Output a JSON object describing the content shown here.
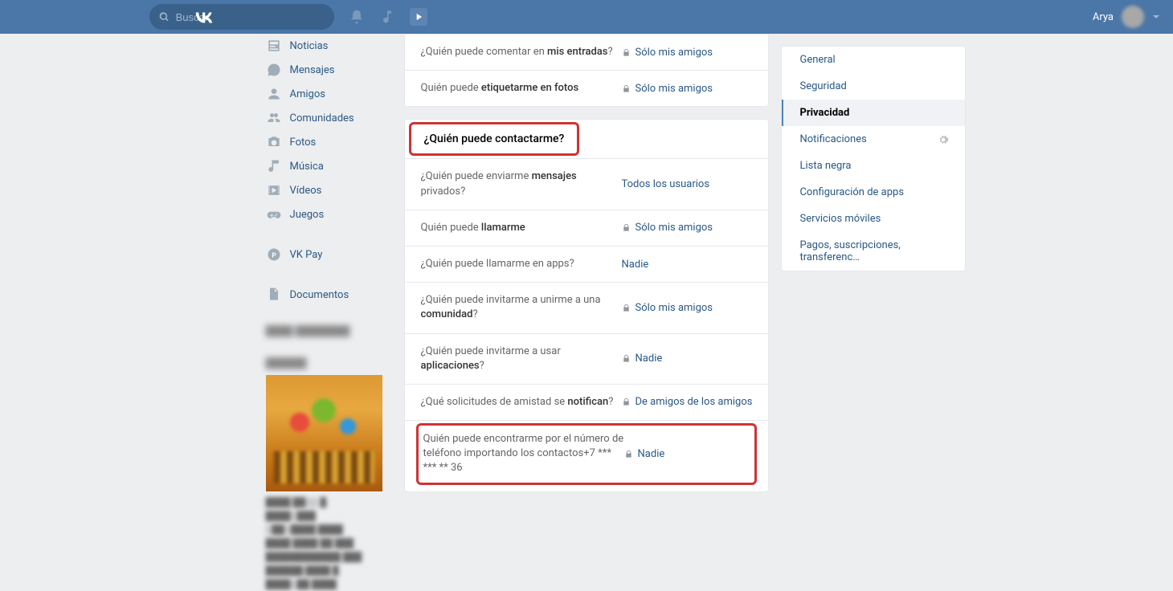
{
  "header": {
    "search_placeholder": "Buscar",
    "username": "Arya"
  },
  "sidebar": {
    "items": [
      {
        "label": "Noticias",
        "icon": "news"
      },
      {
        "label": "Mensajes",
        "icon": "messages"
      },
      {
        "label": "Amigos",
        "icon": "friends"
      },
      {
        "label": "Comunidades",
        "icon": "communities"
      },
      {
        "label": "Fotos",
        "icon": "photos"
      },
      {
        "label": "Música",
        "icon": "music"
      },
      {
        "label": "Vídeos",
        "icon": "videos"
      },
      {
        "label": "Juegos",
        "icon": "games"
      }
    ],
    "vkpay": "VK Pay",
    "documents": "Documentos"
  },
  "main": {
    "section1": {
      "rows": [
        {
          "label_pre": "¿Quién puede comentar en ",
          "label_bold": "mis entradas",
          "label_post": "?",
          "value": "Sólo mis amigos",
          "locked": true
        },
        {
          "label_pre": "Quién puede ",
          "label_bold": "etiquetarme en fotos",
          "label_post": "",
          "value": "Sólo mis amigos",
          "locked": true
        }
      ]
    },
    "section2": {
      "title": "¿Quién puede contactarme?",
      "rows": [
        {
          "label_pre": "¿Quién puede enviarme ",
          "label_bold": "mensajes",
          "label_post": " privados?",
          "value": "Todos los usuarios",
          "locked": false
        },
        {
          "label_pre": "Quién puede ",
          "label_bold": "llamarme",
          "label_post": "",
          "value": "Sólo mis amigos",
          "locked": true
        },
        {
          "label_pre": "¿Quién puede llamarme en apps?",
          "label_bold": "",
          "label_post": "",
          "value": "Nadie",
          "locked": false
        },
        {
          "label_pre": "¿Quién puede invitarme a unirme a una ",
          "label_bold": "comunidad",
          "label_post": "?",
          "value": "Sólo mis amigos",
          "locked": true
        },
        {
          "label_pre": "¿Quién puede invitarme a usar ",
          "label_bold": "aplicaciones",
          "label_post": "?",
          "value": "Nadie",
          "locked": true
        },
        {
          "label_pre": "¿Qué solicitudes de amistad se ",
          "label_bold": "notifican",
          "label_post": "?",
          "value": "De amigos de los amigos",
          "locked": true
        }
      ],
      "phone_row": {
        "label": "Quién puede encontrarme por el número de teléfono importando los contactos+7 *** *** ** 36",
        "value": "Nadie",
        "locked": true
      }
    }
  },
  "nav": {
    "items": [
      {
        "label": "General",
        "active": false
      },
      {
        "label": "Seguridad",
        "active": false
      },
      {
        "label": "Privacidad",
        "active": true
      },
      {
        "label": "Notificaciones",
        "active": false,
        "gear": true
      },
      {
        "label": "Lista negra",
        "active": false
      },
      {
        "label": "Configuración de apps",
        "active": false
      },
      {
        "label": "Servicios móviles",
        "active": false
      },
      {
        "label": "Pagos, suscripciones, transferenc…",
        "active": false
      }
    ]
  }
}
